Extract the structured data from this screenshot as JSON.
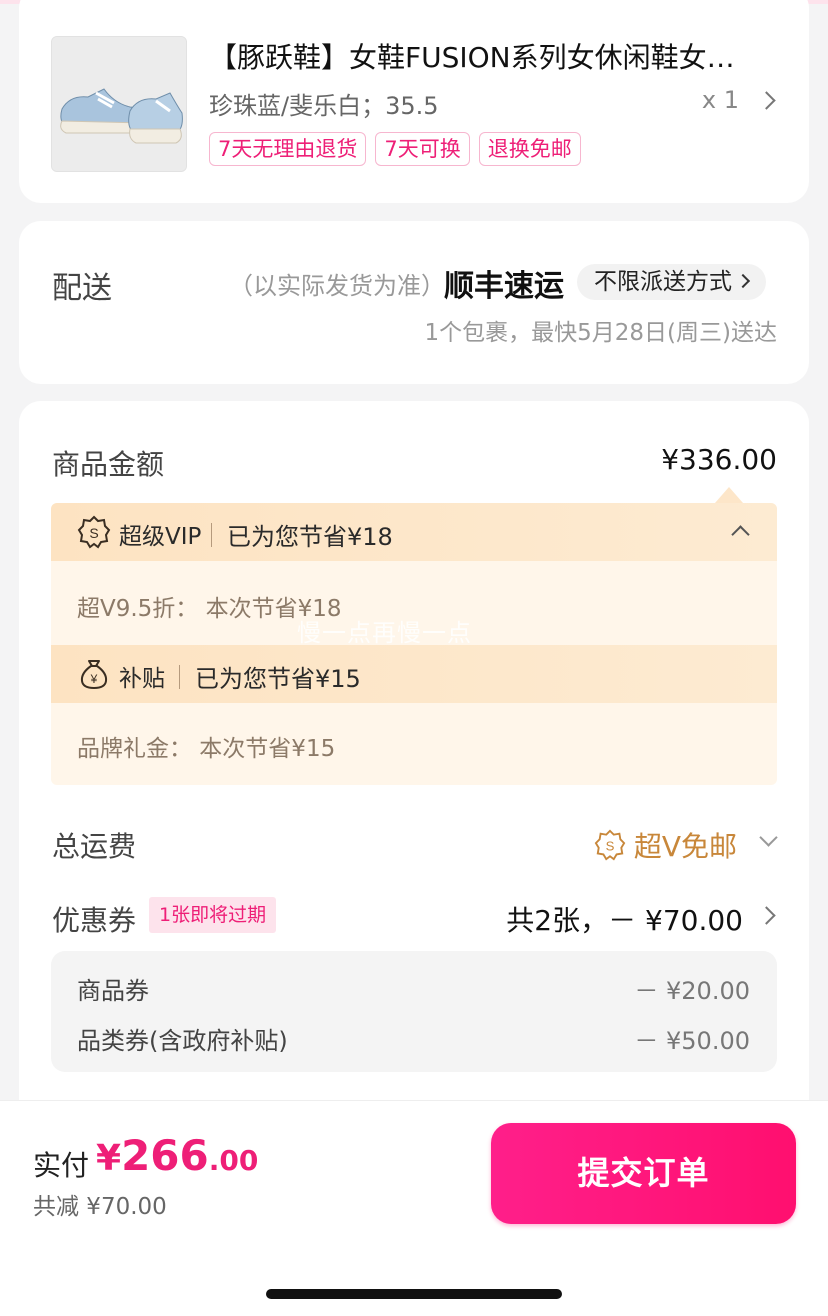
{
  "product": {
    "title": "【豚跃鞋】女鞋FUSION系列女休闲鞋女…",
    "spec": "珍珠蓝/斐乐白；35.5",
    "quantity": "x 1",
    "tags": [
      "7天无理由退货",
      "7天可换",
      "退换免邮"
    ]
  },
  "delivery": {
    "label": "配送",
    "note": "（以实际发货为准）",
    "carrier": "顺丰速运",
    "method": "不限派送方式",
    "eta": "1个包裹，最快5月28日(周三)送达"
  },
  "amount": {
    "goods_label": "商品金额",
    "goods_value": "¥336.00",
    "vip": {
      "title": "超级VIP",
      "saved": "已为您节省¥18",
      "detail": "超V9.5折：  本次节省¥18"
    },
    "subsidy": {
      "title": "补贴",
      "saved": "已为您节省¥15",
      "detail": "品牌礼金：  本次节省¥15"
    },
    "watermark": "慢一点再慢一点",
    "shipping_label": "总运费",
    "shipping_value": "超V免邮",
    "coupon_label": "优惠券",
    "coupon_badge": "1张即将过期",
    "coupon_value": "共2张，－ ¥70.00",
    "coupons": [
      {
        "name": "商品券",
        "value": "－ ¥20.00"
      },
      {
        "name": "品类券(含政府补贴)",
        "value": "－ ¥50.00"
      }
    ]
  },
  "footer": {
    "pay_label": "实付",
    "pay_currency": "¥",
    "pay_int": "266",
    "pay_dec": ".00",
    "reduce": "共减 ¥70.00",
    "submit": "提交订单"
  },
  "colors": {
    "accent": "#ee1f77",
    "gold": "#c8873a",
    "savings_bg": "#fff6ea"
  }
}
